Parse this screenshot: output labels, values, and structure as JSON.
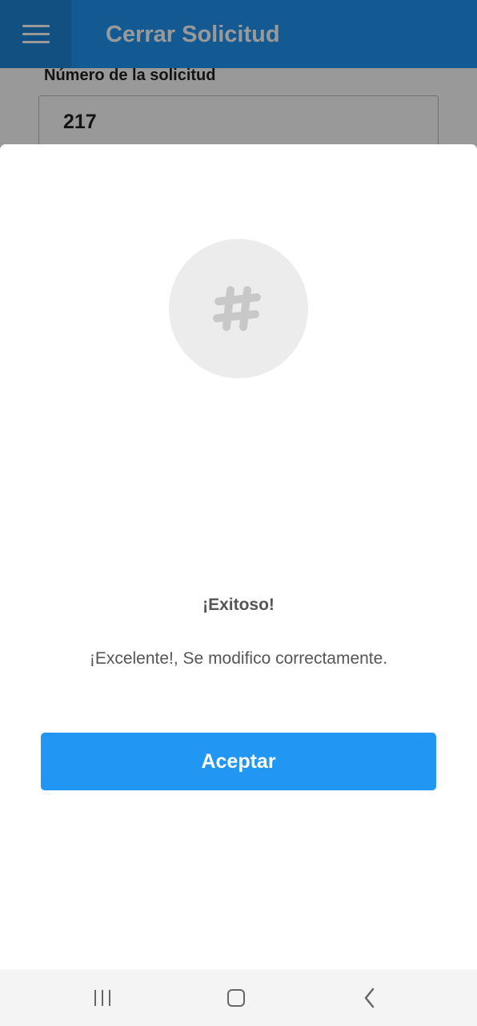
{
  "app_bar": {
    "title": "Cerrar Solicitud",
    "menu_icon": "hamburger-menu-icon",
    "background_color": "#2196f3"
  },
  "form": {
    "request_number_label": "Número de la solicitud",
    "request_number_value": "217"
  },
  "dialog": {
    "icon": "hashtag-icon",
    "title": "¡Exitoso!",
    "message": "¡Excelente!, Se modifico correctamente.",
    "accept_label": "Aceptar",
    "accept_color": "#2196f3"
  },
  "system_nav": {
    "recents_icon": "recent-apps-icon",
    "home_icon": "home-icon",
    "back_icon": "back-icon"
  }
}
